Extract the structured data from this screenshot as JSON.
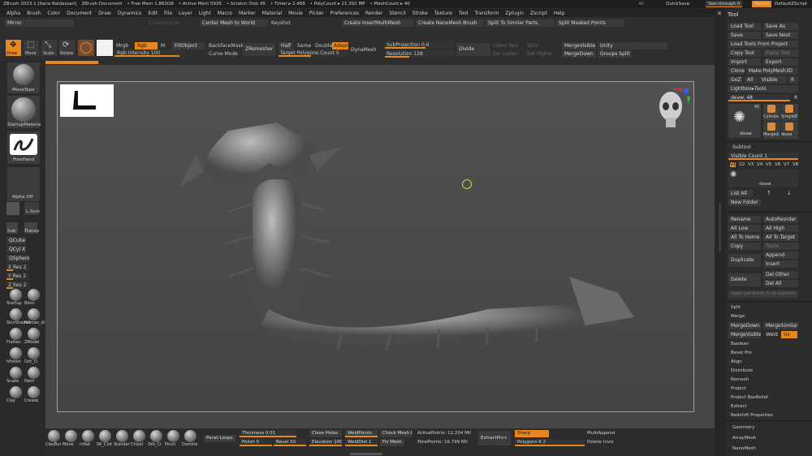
{
  "titlebar": {
    "app": "ZBrush 2023.1 [Ilaria Baldassari]",
    "doc": "ZBrush Document",
    "free_mem": "• Free Mem 1.863GB",
    "active_mem": "• Active Mem 5926",
    "scratch": "• Scratch Disk 45",
    "timer": "• Timer ▸ 2.468",
    "polycount": "• PolyCount ▸ 21.392 MP",
    "meshcount": "• MeshCount ▸ 40",
    "ac": "AC",
    "quicksave": "QuickSave",
    "seethrough": "See-through  0",
    "menus": "Menus",
    "script": "DefaultZScript"
  },
  "menubar": [
    "Alpha",
    "Brush",
    "Color",
    "Document",
    "Draw",
    "Dynamics",
    "Edit",
    "File",
    "Layer",
    "Light",
    "Macro",
    "Marker",
    "Material",
    "Movie",
    "Picker",
    "Preferences",
    "Render",
    "Stencil",
    "Stroke",
    "Texture",
    "Tool",
    "Transform",
    "Zplugin",
    "Zscript",
    "Help"
  ],
  "shelf": {
    "mirror": "Mirror",
    "center_mesh": "Center Mesh to World",
    "keyshot": "Keyshot",
    "create_insert": "Create InsertMultiMesh",
    "create_nano": "Create NanoMesh Brush",
    "split_similar": "Split To Similar Parts",
    "split_masked": "Split Masked Points",
    "draw": "Draw",
    "move": "Move",
    "scale": "Scale",
    "rotate": "Rotate",
    "mrgb": "Mrgb",
    "rgb": "Rgb",
    "m": "M",
    "fillobject": "FillObject",
    "rgb_intensity": "Rgb Intensity 100",
    "backfacemask": "BackfaceMask",
    "curve_mode": "Curve Mode",
    "zremesher": "ZRemesher",
    "half": "Half",
    "same": "Same",
    "double": "Double",
    "adapt": "Adapt",
    "target_poly": "Target Polygons Count 5",
    "dynamesh": "DynaMesh",
    "subprojection": "SubProjection 0.6",
    "resolution": "Resolution 128",
    "divide": "Divide",
    "lower_res": "Lower Res",
    "del_lower": "Del Lower",
    "sdiv": "SDiv",
    "del_higher": "Del Higher",
    "mergevisible": "MergeVisible",
    "mergedown": "MergeDown",
    "unity": "Unity",
    "groups_split": "Groups Split",
    "ghost_row": "CreateCurve"
  },
  "left": {
    "brush": "MoveTopo",
    "material": "StartupMateria",
    "stroke": "FreeHand",
    "alpha": "Alpha Off",
    "lsym": "L.Sym",
    "qcube": "QCube",
    "qcyl": "QCyl X",
    "qsphere": "QSphere",
    "xres": "X Res 2",
    "yres": "Y Res 2",
    "zres": "Z Res 2",
    "sub": "Sub",
    "transp": "Transp",
    "brushes": [
      "Startup",
      "Blinn",
      "SkinShade4",
      "Human_di",
      "Flatten",
      "ZModel",
      "hPolish",
      "Orb_Cl",
      "Snake",
      "Paint",
      "Clay",
      "Crease"
    ]
  },
  "bottom": {
    "brushes": [
      "ClayBui",
      "Move",
      "Inflat",
      "SK_Clot",
      "Standar",
      "Chisel",
      "Orb_Cr",
      "Pinch",
      "Damste"
    ],
    "panel_loops": "Panel Loops",
    "thickness": "Thickness 0.01",
    "polish": "Polish 5",
    "bevel": "Bevel 50",
    "close_holes": "Close Holes",
    "elevation": "Elevation 100",
    "weldpoints": "WeldPoints",
    "welddist": "WeldDist 1",
    "check_mesh": "Check Mesh In",
    "fix_mesh": "Fix Mesh",
    "active_points": "ActivePoints: 11.204 Mil",
    "total_points": "TotalPoints: 16.799 Mil",
    "extractpro": "ExtractPro+",
    "sharp": "Sharp",
    "polygons_k": "Polygons K 2",
    "multiappend": "MultiAppend",
    "delete_invis": "Delete Invis"
  },
  "tool": {
    "title": "Tool",
    "load_tool": "Load Tool",
    "save_as": "Save As",
    "save": "Save",
    "save_next": "Save Next",
    "load_project": "Load Tools From Project",
    "copy_tool": "Copy Tool",
    "paste_tool": "Paste Tool",
    "import": "Import",
    "export": "Export",
    "clone": "Clone",
    "make_polymesh": "Make PolyMesh3D",
    "goz": "GoZ",
    "all": "All",
    "visible": "Visible",
    "r": "R",
    "lightbox": "Lightbox▸Tools",
    "deaw": "deaw. 48",
    "r2": "R",
    "thumb_count": "40",
    "thumb_labels": [
      "deaw",
      "Cylinde",
      "SimpleE",
      "Merged",
      "deaw"
    ],
    "subtool": "Subtool",
    "visible_count": "Visible Count 1",
    "versions": [
      "V1",
      "V2",
      "V3",
      "V4",
      "V5",
      "V6",
      "V7",
      "V8"
    ],
    "item_name": "deaw",
    "list_all": "List All",
    "new_folder": "New Folder",
    "rename": "Rename",
    "autoreorder": "AutoReorder",
    "all_low": "All Low",
    "all_high": "All High",
    "all_to_home": "All To Home",
    "all_to_target": "All To Target",
    "copy": "Copy",
    "paste": "Paste",
    "duplicate": "Duplicate",
    "append": "Append",
    "insert": "Insert",
    "delete": "Delete",
    "del_other": "Del Other",
    "del_all": "Del All",
    "apply_list": "Apply List Action To All Subtools",
    "sections": [
      "Split",
      "Merge"
    ],
    "mergedown": "MergeDown",
    "mergesimilar": "MergeSimilar",
    "mergevisible": "MergeVisible",
    "weld": "Weld",
    "uv": "Uv",
    "sub_sections": [
      "Boolean",
      "Bevel Pro",
      "Align",
      "Distribute",
      "Remesh",
      "Project",
      "Project BasRelief",
      "Extract",
      "Redshift Properties"
    ],
    "bottom_sections": [
      "Geometry",
      "ArrayMesh",
      "NanoMesh"
    ]
  },
  "accent": "#e8871e"
}
